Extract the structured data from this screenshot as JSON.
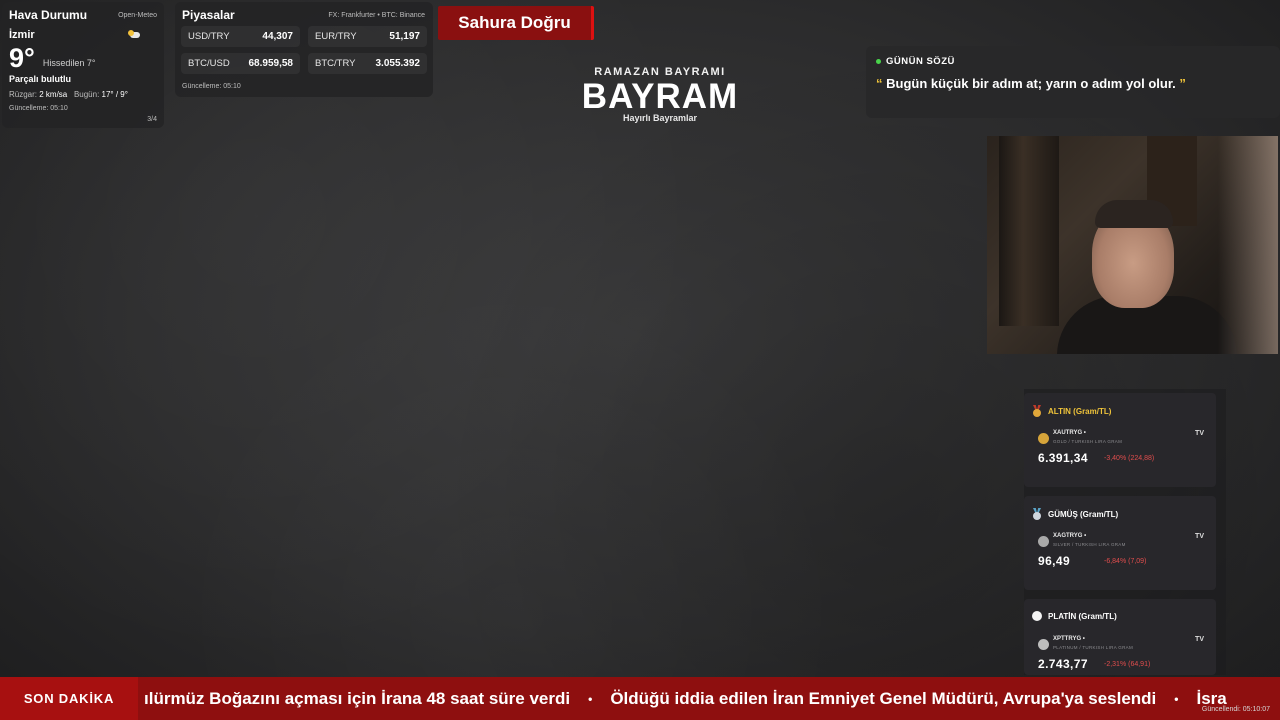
{
  "weather": {
    "title": "Hava Durumu",
    "source": "Open-Meteo",
    "city": "İzmir",
    "temperature": "9°",
    "feels_like": "Hissedilen 7°",
    "condition": "Parçalı bulutlu",
    "wind_label": "Rüzgar:",
    "wind_value": "2 km/sa",
    "today_label": "Bugün:",
    "today_value": "17° / 9°",
    "updated": "Güncelleme: 05:10",
    "page": "3/4",
    "icon": "partly-cloudy-icon"
  },
  "markets": {
    "title": "Piyasalar",
    "source": "FX: Frankfurter • BTC: Binance",
    "rates": [
      {
        "symbol": "USD/TRY",
        "value": "44,307"
      },
      {
        "symbol": "EUR/TRY",
        "value": "51,197"
      },
      {
        "symbol": "BTC/USD",
        "value": "68.959,58"
      },
      {
        "symbol": "BTC/TRY",
        "value": "3.055.392"
      }
    ],
    "updated": "Güncelleme: 05:10"
  },
  "badge": {
    "label": "Sahura Doğru",
    "color": "#8a1010"
  },
  "center": {
    "subtitle": "RAMAZAN BAYRAMI",
    "title": "BAYRAM",
    "wish": "Hayırlı Bayramlar"
  },
  "quote": {
    "label": "GÜNÜN SÖZÜ",
    "open_mark": "“",
    "text": "Bugün küçük bir adım at; yarın o adım yol olur.",
    "close_mark": "”"
  },
  "commodities": [
    {
      "name": "ALTIN (Gram/TL)",
      "ticker": "XAUTRYG •",
      "description": "GOLD / TURKISH LIRA GRAM",
      "tv": "TV",
      "price": "6.391,34",
      "change": "-3,40% (224,88)",
      "icon": "gold-medal-icon"
    },
    {
      "name": "GÜMÜŞ (Gram/TL)",
      "ticker": "XAGTRYG •",
      "description": "SILVER / TURKISH LIRA GRAM",
      "tv": "TV",
      "price": "96,49",
      "change": "-6,84% (7,09)",
      "icon": "silver-medal-icon"
    },
    {
      "name": "PLATİN (Gram/TL)",
      "ticker": "XPTTRYG •",
      "description": "PLATINUM / TURKISH LIRA GRAM",
      "tv": "TV",
      "price": "2.743,77",
      "change": "-2,31% (64,91)",
      "icon": "platinum-dot-icon"
    }
  ],
  "ticker": {
    "label": "SON DAKİKA",
    "items": [
      "ılürmüz Boğazını açması için İrana 48 saat süre verdi",
      "Öldüğü iddia edilen İran Emniyet Genel Müdürü, Avrupa'ya seslendi",
      "İsra"
    ],
    "separator": "•",
    "updated": "Güncellendi: 05:10:07"
  },
  "colors": {
    "accent_red": "#8e0f0f",
    "positive_green": "#49d44b",
    "negative_red": "#e04d4d",
    "quote_gold": "#f0c43a"
  }
}
